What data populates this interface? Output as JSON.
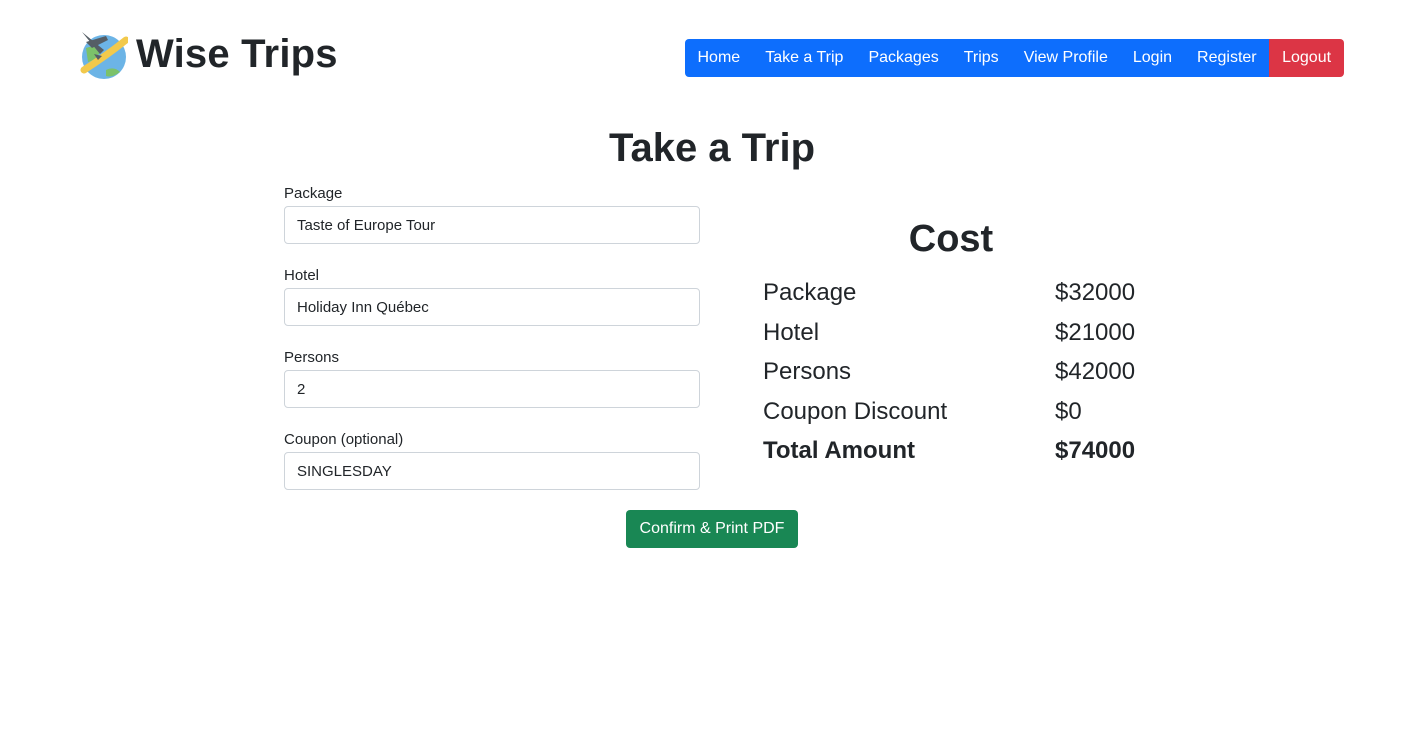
{
  "app": {
    "title": "Wise Trips"
  },
  "nav": {
    "items": [
      {
        "label": "Home"
      },
      {
        "label": "Take a Trip"
      },
      {
        "label": "Packages"
      },
      {
        "label": "Trips"
      },
      {
        "label": "View Profile"
      },
      {
        "label": "Login"
      },
      {
        "label": "Register"
      }
    ],
    "logout_label": "Logout"
  },
  "page": {
    "title": "Take a Trip"
  },
  "form": {
    "package": {
      "label": "Package",
      "value": "Taste of Europe Tour"
    },
    "hotel": {
      "label": "Hotel",
      "value": "Holiday Inn Québec"
    },
    "persons": {
      "label": "Persons",
      "value": "2"
    },
    "coupon": {
      "label": "Coupon (optional)",
      "value": "SINGLESDAY"
    }
  },
  "cost": {
    "title": "Cost",
    "rows": [
      {
        "label": "Package",
        "value": "$32000"
      },
      {
        "label": "Hotel",
        "value": "$21000"
      },
      {
        "label": "Persons",
        "value": "$42000"
      },
      {
        "label": "Coupon Discount",
        "value": "$0"
      }
    ],
    "total": {
      "label": "Total Amount",
      "value": "$74000"
    }
  },
  "actions": {
    "confirm_label": "Confirm & Print PDF"
  },
  "colors": {
    "primary": "#0d6efd",
    "danger": "#dc3545",
    "success": "#198754",
    "text": "#212529"
  },
  "icons": {
    "logo": "globe-airplane-icon"
  }
}
